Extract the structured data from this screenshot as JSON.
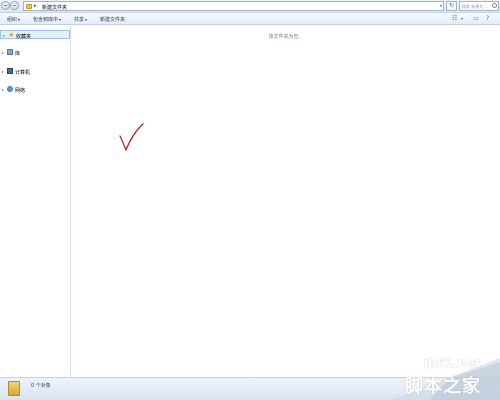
{
  "address": {
    "path_segment": "新建文件夹",
    "search_placeholder": "搜索 新建文..."
  },
  "toolbar": {
    "organize": "组织",
    "include_in_library": "包含到库中",
    "share": "共享",
    "new_folder": "新建文件夹"
  },
  "sidebar": {
    "items": [
      {
        "label": "收藏夹",
        "icon": "star-icon"
      },
      {
        "label": "库",
        "icon": "library-icon"
      },
      {
        "label": "计算机",
        "icon": "computer-icon"
      },
      {
        "label": "网络",
        "icon": "network-icon"
      }
    ]
  },
  "content": {
    "empty_message": "该文件夹为空。"
  },
  "details": {
    "object_count": "0 个对象"
  },
  "watermark": {
    "url": "jb51.net",
    "name": "脚本之家"
  },
  "colors": {
    "checkmark": "#b5241c",
    "folder": "#e8c252"
  }
}
